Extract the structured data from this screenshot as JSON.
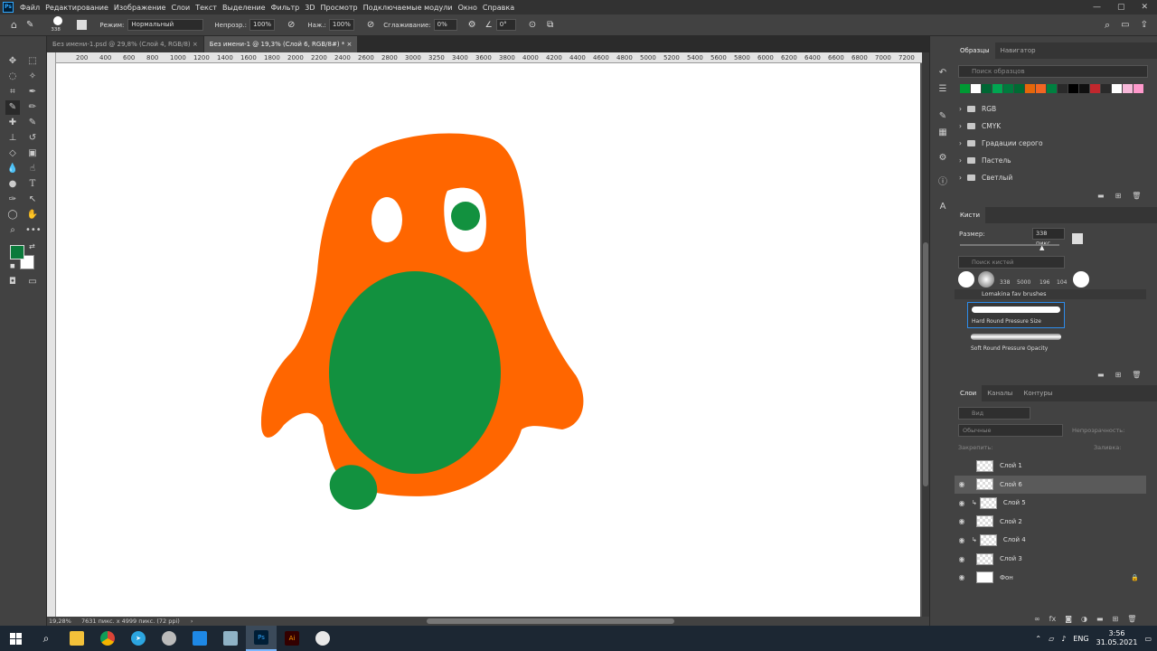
{
  "menu": {
    "items": [
      "Файл",
      "Редактирование",
      "Изображение",
      "Слои",
      "Текст",
      "Выделение",
      "Фильтр",
      "3D",
      "Просмотр",
      "Подключаемые модули",
      "Окно",
      "Справка"
    ],
    "ps": "Ps"
  },
  "options": {
    "brush_size": "338",
    "mode_label": "Режим:",
    "mode_value": "Нормальный",
    "opacity_label": "Непрозр.:",
    "opacity_value": "100%",
    "flow_label": "Наж.:",
    "flow_value": "100%",
    "smoothing_label": "Сглаживание:",
    "smoothing_value": "0%",
    "angle_value": "0°"
  },
  "tabs": [
    {
      "label": "Без имени-1.psd @ 29,8% (Слой 4, RGB/8)"
    },
    {
      "label": "Без имени-1 @ 19,3% (Слой 6, RGB/8#) *"
    }
  ],
  "ruler": [
    "200",
    "400",
    "600",
    "800",
    "1000",
    "1200",
    "1400",
    "1600",
    "1800",
    "2000",
    "2200",
    "2400",
    "2600",
    "2800",
    "3000",
    "3250",
    "3400",
    "3600",
    "3800",
    "4000",
    "4200",
    "4400",
    "4600",
    "4800",
    "5000",
    "5200",
    "5400",
    "5600",
    "5800",
    "6000",
    "6200",
    "6400",
    "6600",
    "6800",
    "7000",
    "7200",
    "7400"
  ],
  "status": {
    "zoom": "19,28%",
    "size": "7631 пикс. x 4999 пикс. (72 ppi)"
  },
  "swatches_panel": {
    "tab1": "Образцы",
    "tab2": "Навигатор",
    "search": "Поиск образцов",
    "colors": [
      "#009933",
      "#ffffff",
      "#006633",
      "#00a651",
      "#007a3d",
      "#006b33",
      "#e5670a",
      "#f26522",
      "#008040",
      "#2a2a2a",
      "#000000",
      "#101010",
      "#c1272d",
      "#2a2a2a",
      "#ffffff",
      "#f7b8d9",
      "#ff99cc"
    ],
    "folders": [
      "RGB",
      "CMYK",
      "Градации серого",
      "Пастель",
      "Светлый"
    ]
  },
  "brushes_panel": {
    "tab": "Кисти",
    "size_label": "Размер:",
    "size_value": "338 пикс.",
    "search": "Поиск кистей",
    "presets": [
      "338",
      "5000",
      "196",
      "104"
    ],
    "group": "Lomakina fav brushes",
    "brush1": "Hard Round Pressure Size",
    "brush2": "Soft Round Pressure Opacity"
  },
  "layers_panel": {
    "tabs": [
      "Слои",
      "Каналы",
      "Контуры"
    ],
    "kind": "Вид",
    "blend": "Обычные",
    "opacity_label": "Непрозрачность:",
    "lock_label": "Закрепить:",
    "fill_label": "Заливка:",
    "layers": [
      {
        "name": "Слой 1",
        "visible": false
      },
      {
        "name": "Слой 6",
        "visible": true,
        "selected": true
      },
      {
        "name": "Слой 5",
        "visible": true,
        "clip": true
      },
      {
        "name": "Слой 2",
        "visible": true
      },
      {
        "name": "Слой 4",
        "visible": true,
        "clip": true
      },
      {
        "name": "Слой 3",
        "visible": true
      },
      {
        "name": "Фон",
        "visible": true,
        "locked": true
      }
    ]
  },
  "taskbar": {
    "lang": "ENG",
    "time": "3:56",
    "date": "31.05.2021"
  },
  "colors": {
    "orange": "#ff6600",
    "green": "#12913f",
    "fg": "#0b7a3b"
  }
}
